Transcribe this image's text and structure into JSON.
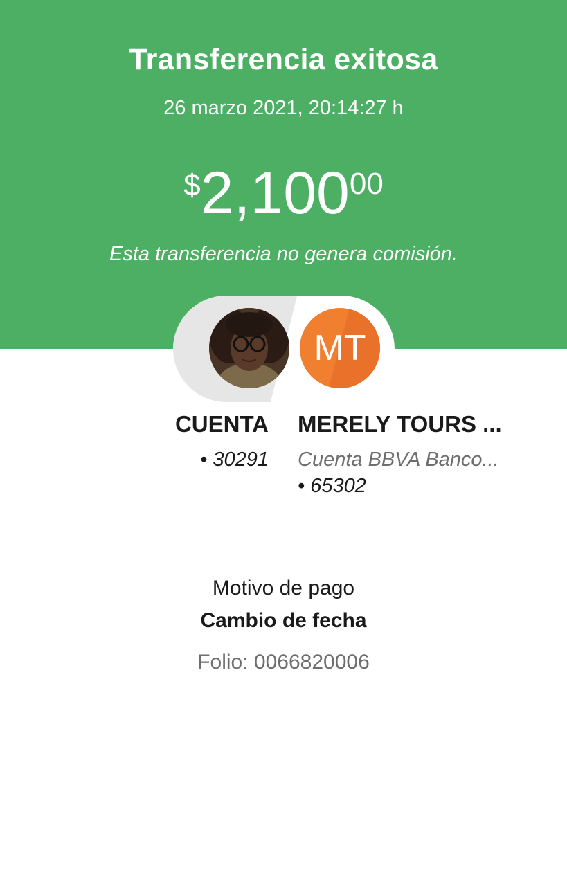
{
  "header": {
    "title": "Transferencia exitosa",
    "datetime": "26 marzo 2021, 20:14:27 h",
    "amount": {
      "currency": "$",
      "integer": "2,100",
      "decimals": "00"
    },
    "fee_note": "Esta transferencia no genera comisión.",
    "background_color": "#4caf64"
  },
  "parties": {
    "from": {
      "avatar": "user-photo",
      "name": "CUENTA",
      "account": "• 30291"
    },
    "to": {
      "avatar_initials": "MT",
      "avatar_color": "#f07f30",
      "name": "MERELY TOURS ...",
      "bank": "Cuenta BBVA Banco...",
      "account": "• 65302"
    }
  },
  "details": {
    "reason_label": "Motivo de pago",
    "reason_value": "Cambio de fecha",
    "folio": "Folio: 0066820006"
  }
}
